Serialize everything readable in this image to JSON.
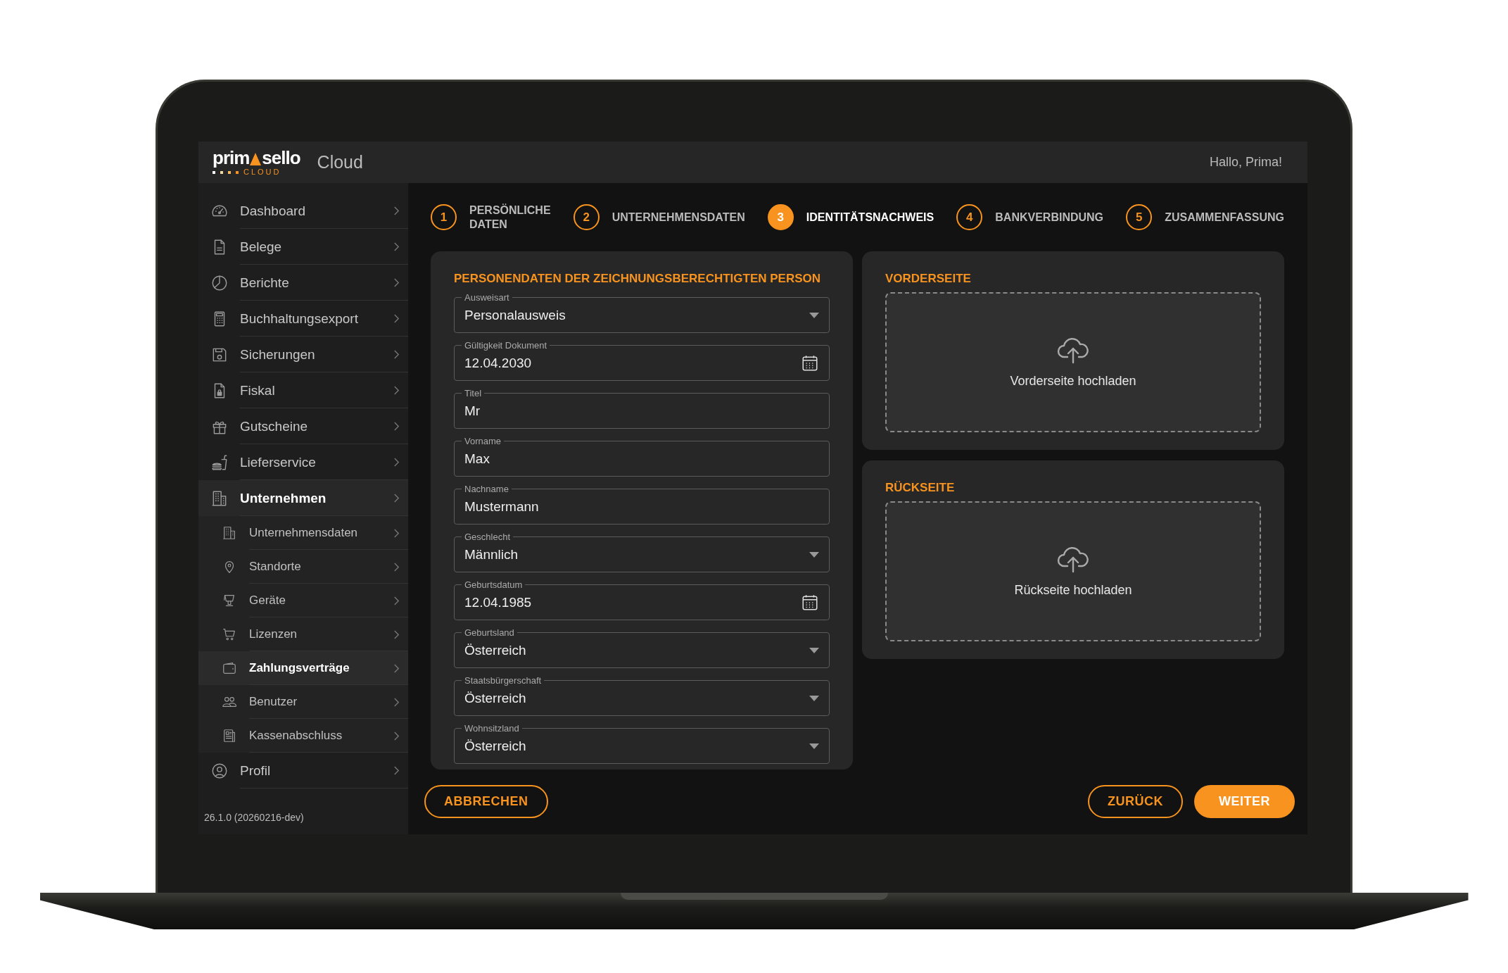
{
  "header": {
    "logo": {
      "left": "prim",
      "right": "sello",
      "sub": "CLOUD"
    },
    "app_name": "Cloud",
    "greeting": "Hallo, Prima!"
  },
  "sidebar": {
    "items": [
      {
        "label": "Dashboard",
        "expanded": false
      },
      {
        "label": "Belege",
        "expanded": false
      },
      {
        "label": "Berichte",
        "expanded": false
      },
      {
        "label": "Buchhaltungsexport",
        "expanded": false
      },
      {
        "label": "Sicherungen",
        "expanded": false
      },
      {
        "label": "Fiskal",
        "expanded": false
      },
      {
        "label": "Gutscheine",
        "expanded": false
      },
      {
        "label": "Lieferservice",
        "expanded": false
      },
      {
        "label": "Unternehmen",
        "expanded": true,
        "children": [
          {
            "label": "Unternehmensdaten",
            "selected": false
          },
          {
            "label": "Standorte",
            "selected": false
          },
          {
            "label": "Geräte",
            "selected": false
          },
          {
            "label": "Lizenzen",
            "selected": false
          },
          {
            "label": "Zahlungsverträge",
            "selected": true
          },
          {
            "label": "Benutzer",
            "selected": false
          },
          {
            "label": "Kassenabschluss",
            "selected": false
          }
        ]
      },
      {
        "label": "Profil",
        "expanded": false
      }
    ],
    "version": "26.1.0 (20260216-dev)"
  },
  "steps": [
    {
      "number": "1",
      "label": "PERSÖNLICHE DATEN",
      "selected": false
    },
    {
      "number": "2",
      "label": "UNTERNEHMENSDATEN",
      "selected": false
    },
    {
      "number": "3",
      "label": "IDENTITÄTSNACHWEIS",
      "selected": true
    },
    {
      "number": "4",
      "label": "BANKVERBINDUNG",
      "selected": false
    },
    {
      "number": "5",
      "label": "ZUSAMMENFASSUNG",
      "selected": false
    }
  ],
  "form": {
    "title": "PERSONENDATEN DER ZEICHNUNGSBERECHTIGTEN PERSON",
    "fields": [
      {
        "kind": "select",
        "label": "Ausweisart",
        "value": "Personalausweis"
      },
      {
        "kind": "date",
        "label": "Gültigkeit Dokument",
        "value": "12.04.2030"
      },
      {
        "kind": "text",
        "label": "Titel",
        "value": "Mr"
      },
      {
        "kind": "text",
        "label": "Vorname",
        "value": "Max"
      },
      {
        "kind": "text",
        "label": "Nachname",
        "value": "Mustermann"
      },
      {
        "kind": "select",
        "label": "Geschlecht",
        "value": "Männlich"
      },
      {
        "kind": "date",
        "label": "Geburtsdatum",
        "value": "12.04.1985"
      },
      {
        "kind": "select",
        "label": "Geburtsland",
        "value": "Österreich"
      },
      {
        "kind": "select",
        "label": "Staatsbürgerschaft",
        "value": "Österreich"
      },
      {
        "kind": "select",
        "label": "Wohnsitzland",
        "value": "Österreich"
      }
    ]
  },
  "uploads": [
    {
      "title": "VORDERSEITE",
      "action": "Vorderseite hochladen"
    },
    {
      "title": "RÜCKSEITE",
      "action": "Rückseite hochladen"
    }
  ],
  "footer": {
    "cancel": "ABBRECHEN",
    "back": "ZURÜCK",
    "next": "WEITER"
  }
}
